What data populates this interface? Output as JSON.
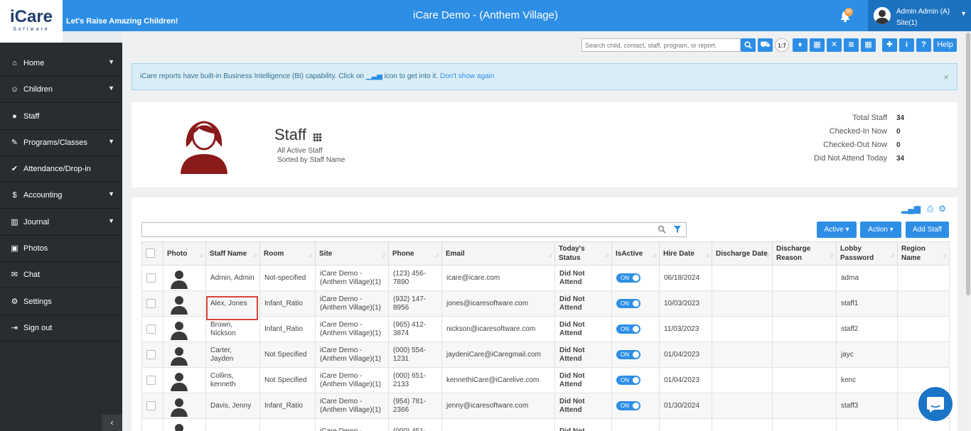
{
  "app": {
    "logo": "iCare",
    "logo_sub": "Software",
    "tagline": "Let's Raise Amazing Children!",
    "title": "iCare Demo - (Anthem Village)",
    "notification_count": "65",
    "user_name": "Admin Admin (A)",
    "user_site": "Site(1)"
  },
  "sidebar": {
    "items": [
      {
        "label": "Home",
        "icon": "home-icon",
        "has_caret": true
      },
      {
        "label": "Children",
        "icon": "smile-icon",
        "has_caret": true
      },
      {
        "label": "Staff",
        "icon": "user-icon",
        "has_caret": false
      },
      {
        "label": "Programs/Classes",
        "icon": "pencil-icon",
        "has_caret": true
      },
      {
        "label": "Attendance/Drop-in",
        "icon": "check-circle-icon",
        "has_caret": false
      },
      {
        "label": "Accounting",
        "icon": "dollar-icon",
        "has_caret": true
      },
      {
        "label": "Journal",
        "icon": "bar-chart-icon",
        "has_caret": true
      },
      {
        "label": "Photos",
        "icon": "photo-icon",
        "has_caret": false
      },
      {
        "label": "Chat",
        "icon": "chat-icon",
        "has_caret": false
      },
      {
        "label": "Settings",
        "icon": "gear-icon",
        "has_caret": false
      },
      {
        "label": "Sign out",
        "icon": "sign-out-icon",
        "has_caret": false
      }
    ]
  },
  "toolbar": {
    "search_placeholder": "Search child, contact, staff, program, or report.",
    "ratio_label": "1:7",
    "info_label": "i",
    "question_label": "?",
    "help_label": "Help"
  },
  "alert": {
    "text_before": "iCare reports have built-in Business Intelligence (BI) capability. Click on",
    "text_after": "icon to get into it.",
    "link": "Don't show again",
    "close": "×"
  },
  "header": {
    "title": "Staff",
    "sub1": "All Active Staff",
    "sub2": "Sorted by Staff Name",
    "stats": [
      {
        "label": "Total Staff",
        "value": "34"
      },
      {
        "label": "Checked-In Now",
        "value": "0"
      },
      {
        "label": "Checked-Out Now",
        "value": "0"
      },
      {
        "label": "Did Not Attend Today",
        "value": "34"
      }
    ]
  },
  "actions": {
    "active_label": "Active ▾",
    "action_label": "Action ▾",
    "add_staff_label": "Add Staff"
  },
  "table": {
    "columns": [
      "",
      "Photo",
      "Staff Name",
      "Room",
      "Site",
      "Phone",
      "Email",
      "Today's Status",
      "IsActive",
      "Hire Date",
      "Discharge Date",
      "Discharge Reason",
      "Lobby Password",
      "Region Name"
    ],
    "toggle_label": "ON",
    "rows": [
      {
        "name": "Admin, Admin",
        "room": "Not-specified",
        "site": "iCare Demo - (Anthem Village)(1)",
        "phone": "(123) 456-7890",
        "email": "icare@icare.com",
        "status": "Did Not Attend",
        "hire": "06/18/2024",
        "discharge_date": "",
        "discharge_reason": "",
        "lobby": "adma",
        "region": ""
      },
      {
        "name": "Alex, Jones",
        "room": "Infant_Ratio",
        "site": "iCare Demo - (Anthem Village)(1)",
        "phone": "(932) 147-8956",
        "email": "jones@icaresoftware.com",
        "status": "Did Not Attend",
        "hire": "10/03/2023",
        "discharge_date": "",
        "discharge_reason": "",
        "lobby": "staff1",
        "region": ""
      },
      {
        "name": "Brown, Nickson",
        "room": "Infant_Ratio",
        "site": "iCare Demo - (Anthem Village)(1)",
        "phone": "(965) 412-3874",
        "email": "nickson@icaresoftware.com",
        "status": "Did Not Attend",
        "hire": "11/03/2023",
        "discharge_date": "",
        "discharge_reason": "",
        "lobby": "staff2",
        "region": ""
      },
      {
        "name": "Carter, Jayden",
        "room": "Not Specified",
        "site": "iCare Demo - (Anthem Village)(1)",
        "phone": "(000) 554-1231",
        "email": "jaydeniCare@iCaregmail.com",
        "status": "Did Not Attend",
        "hire": "01/04/2023",
        "discharge_date": "",
        "discharge_reason": "",
        "lobby": "jayc",
        "region": ""
      },
      {
        "name": "Collins, kenneth",
        "room": "Not Specified",
        "site": "iCare Demo - (Anthem Village)(1)",
        "phone": "(000) 651-2133",
        "email": "kennethiCare@iCarelive.com",
        "status": "Did Not Attend",
        "hire": "01/04/2023",
        "discharge_date": "",
        "discharge_reason": "",
        "lobby": "kenc",
        "region": ""
      },
      {
        "name": "Davis, Jenny",
        "room": "Infant_Ratio",
        "site": "iCare Demo - (Anthem Village)(1)",
        "phone": "(954) 781-2366",
        "email": "jenny@icaresoftware.com",
        "status": "Did Not Attend",
        "hire": "01/30/2024",
        "discharge_date": "",
        "discharge_reason": "",
        "lobby": "staff3",
        "region": ""
      },
      {
        "name": "",
        "room": "",
        "site": "iCare Demo -",
        "phone": "(000) 451-",
        "email": "",
        "status": "Did Not",
        "hire": "",
        "discharge_date": "",
        "discharge_reason": "",
        "lobby": "",
        "region": ""
      }
    ]
  },
  "colors": {
    "primary": "#2d8ee6",
    "sidebar": "#2a2d30",
    "status_red": "#d9221b",
    "alert_bg": "#d9edf7",
    "avatar_red": "#8b1a1a"
  }
}
